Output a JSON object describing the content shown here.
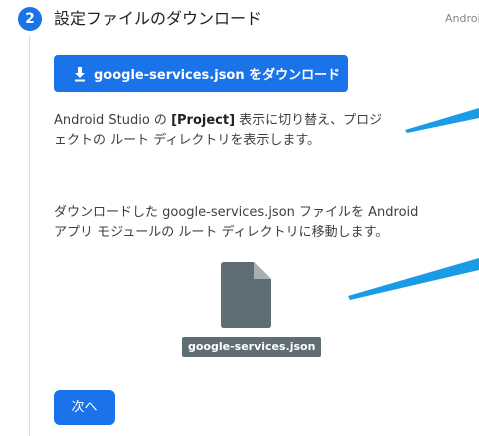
{
  "step": {
    "number": "2",
    "title": "設定ファイルのダウンロード",
    "side_label": "Androi"
  },
  "download_button": {
    "label": "google-services.json をダウンロード",
    "icon": "download-icon"
  },
  "instruction1": {
    "part1": "Android Studio の ",
    "bold": "[Project]",
    "part2": " 表示に切り替え、プロジ",
    "line2": "ェクトの ルート ディレクトリを表示します。"
  },
  "instruction2": {
    "line1": "ダウンロードした google-services.json ファイルを Android",
    "line2": "アプリ モジュールの ルート ディレクトリに移動します。"
  },
  "file": {
    "icon": "file-icon",
    "label": "google-services.json"
  },
  "next_button": {
    "label": "次へ"
  },
  "colors": {
    "primary": "#1a73e8",
    "callout": "#1a9be6",
    "file_icon": "#5f6d74",
    "text": "#3c4043"
  }
}
